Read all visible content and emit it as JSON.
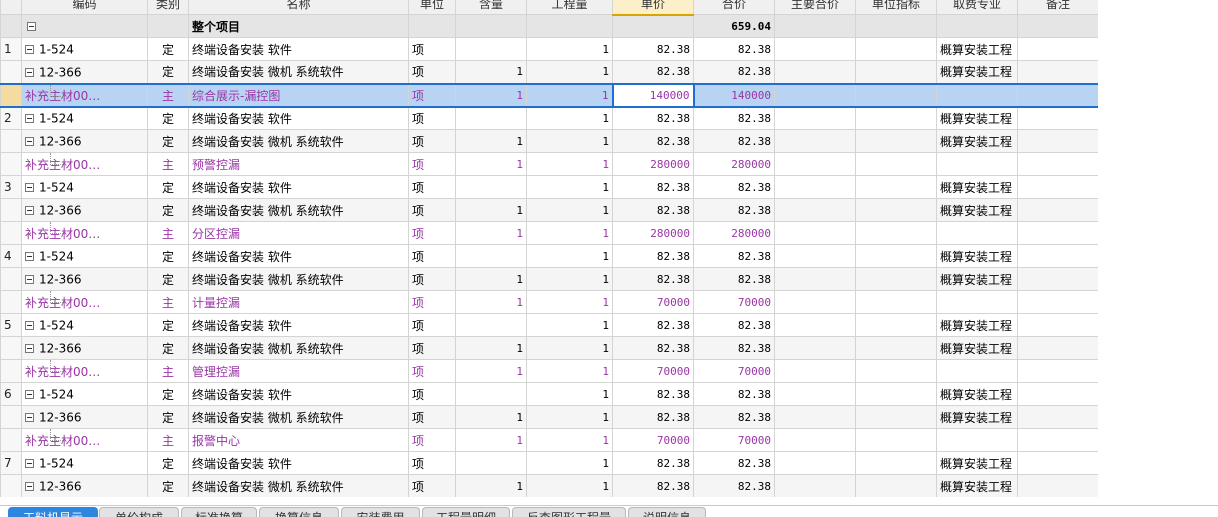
{
  "columns": [
    "编码",
    "类别",
    "名称",
    "单位",
    "含量",
    "工程量",
    "单价",
    "合价",
    "主要合价",
    "单位指标",
    "取费专业",
    "备注"
  ],
  "total": {
    "name": "整个项目",
    "amount": "659.04"
  },
  "rows": [
    {
      "rn": "1",
      "code": "1-524",
      "cat": "定",
      "name": "终端设备安装 软件",
      "unit": "项",
      "content": "",
      "qty": "1",
      "price": "82.38",
      "amount": "82.38",
      "fee": "概算安装工程"
    },
    {
      "rn": "",
      "code": "12-366",
      "cat": "定",
      "name": "终端设备安装 微机 系统软件",
      "unit": "项",
      "content": "1",
      "qty": "1",
      "price": "82.38",
      "amount": "82.38",
      "fee": "概算安装工程"
    },
    {
      "rn": "",
      "code": "补充主材00…",
      "cat": "主",
      "name": "综合展示-漏控图",
      "unit": "项",
      "content": "1",
      "qty": "1",
      "price": "140000",
      "amount": "140000",
      "fee": ""
    },
    {
      "rn": "2",
      "code": "1-524",
      "cat": "定",
      "name": "终端设备安装 软件",
      "unit": "项",
      "content": "",
      "qty": "1",
      "price": "82.38",
      "amount": "82.38",
      "fee": "概算安装工程"
    },
    {
      "rn": "",
      "code": "12-366",
      "cat": "定",
      "name": "终端设备安装 微机 系统软件",
      "unit": "项",
      "content": "1",
      "qty": "1",
      "price": "82.38",
      "amount": "82.38",
      "fee": "概算安装工程"
    },
    {
      "rn": "",
      "code": "补充主材00…",
      "cat": "主",
      "name": "预警控漏",
      "unit": "项",
      "content": "1",
      "qty": "1",
      "price": "280000",
      "amount": "280000",
      "fee": ""
    },
    {
      "rn": "3",
      "code": "1-524",
      "cat": "定",
      "name": "终端设备安装 软件",
      "unit": "项",
      "content": "",
      "qty": "1",
      "price": "82.38",
      "amount": "82.38",
      "fee": "概算安装工程"
    },
    {
      "rn": "",
      "code": "12-366",
      "cat": "定",
      "name": "终端设备安装 微机 系统软件",
      "unit": "项",
      "content": "1",
      "qty": "1",
      "price": "82.38",
      "amount": "82.38",
      "fee": "概算安装工程"
    },
    {
      "rn": "",
      "code": "补充主材00…",
      "cat": "主",
      "name": "分区控漏",
      "unit": "项",
      "content": "1",
      "qty": "1",
      "price": "280000",
      "amount": "280000",
      "fee": ""
    },
    {
      "rn": "4",
      "code": "1-524",
      "cat": "定",
      "name": "终端设备安装 软件",
      "unit": "项",
      "content": "",
      "qty": "1",
      "price": "82.38",
      "amount": "82.38",
      "fee": "概算安装工程"
    },
    {
      "rn": "",
      "code": "12-366",
      "cat": "定",
      "name": "终端设备安装 微机 系统软件",
      "unit": "项",
      "content": "1",
      "qty": "1",
      "price": "82.38",
      "amount": "82.38",
      "fee": "概算安装工程"
    },
    {
      "rn": "",
      "code": "补充主材00…",
      "cat": "主",
      "name": "计量控漏",
      "unit": "项",
      "content": "1",
      "qty": "1",
      "price": "70000",
      "amount": "70000",
      "fee": ""
    },
    {
      "rn": "5",
      "code": "1-524",
      "cat": "定",
      "name": "终端设备安装 软件",
      "unit": "项",
      "content": "",
      "qty": "1",
      "price": "82.38",
      "amount": "82.38",
      "fee": "概算安装工程"
    },
    {
      "rn": "",
      "code": "12-366",
      "cat": "定",
      "name": "终端设备安装 微机 系统软件",
      "unit": "项",
      "content": "1",
      "qty": "1",
      "price": "82.38",
      "amount": "82.38",
      "fee": "概算安装工程"
    },
    {
      "rn": "",
      "code": "补充主材00…",
      "cat": "主",
      "name": "管理控漏",
      "unit": "项",
      "content": "1",
      "qty": "1",
      "price": "70000",
      "amount": "70000",
      "fee": ""
    },
    {
      "rn": "6",
      "code": "1-524",
      "cat": "定",
      "name": "终端设备安装 软件",
      "unit": "项",
      "content": "",
      "qty": "1",
      "price": "82.38",
      "amount": "82.38",
      "fee": "概算安装工程"
    },
    {
      "rn": "",
      "code": "12-366",
      "cat": "定",
      "name": "终端设备安装 微机 系统软件",
      "unit": "项",
      "content": "1",
      "qty": "1",
      "price": "82.38",
      "amount": "82.38",
      "fee": "概算安装工程"
    },
    {
      "rn": "",
      "code": "补充主材00…",
      "cat": "主",
      "name": "报警中心",
      "unit": "项",
      "content": "1",
      "qty": "1",
      "price": "70000",
      "amount": "70000",
      "fee": ""
    },
    {
      "rn": "7",
      "code": "1-524",
      "cat": "定",
      "name": "终端设备安装 软件",
      "unit": "项",
      "content": "",
      "qty": "1",
      "price": "82.38",
      "amount": "82.38",
      "fee": "概算安装工程"
    },
    {
      "rn": "",
      "code": "12-366",
      "cat": "定",
      "name": "终端设备安装 微机 系统软件",
      "unit": "项",
      "content": "1",
      "qty": "1",
      "price": "82.38",
      "amount": "82.38",
      "fee": "概算安装工程"
    }
  ],
  "tabs": [
    "工料机显示",
    "单价构成",
    "标准换算",
    "换算信息",
    "安装费用",
    "工程量明细",
    "反查图形工程量",
    "说明信息"
  ]
}
